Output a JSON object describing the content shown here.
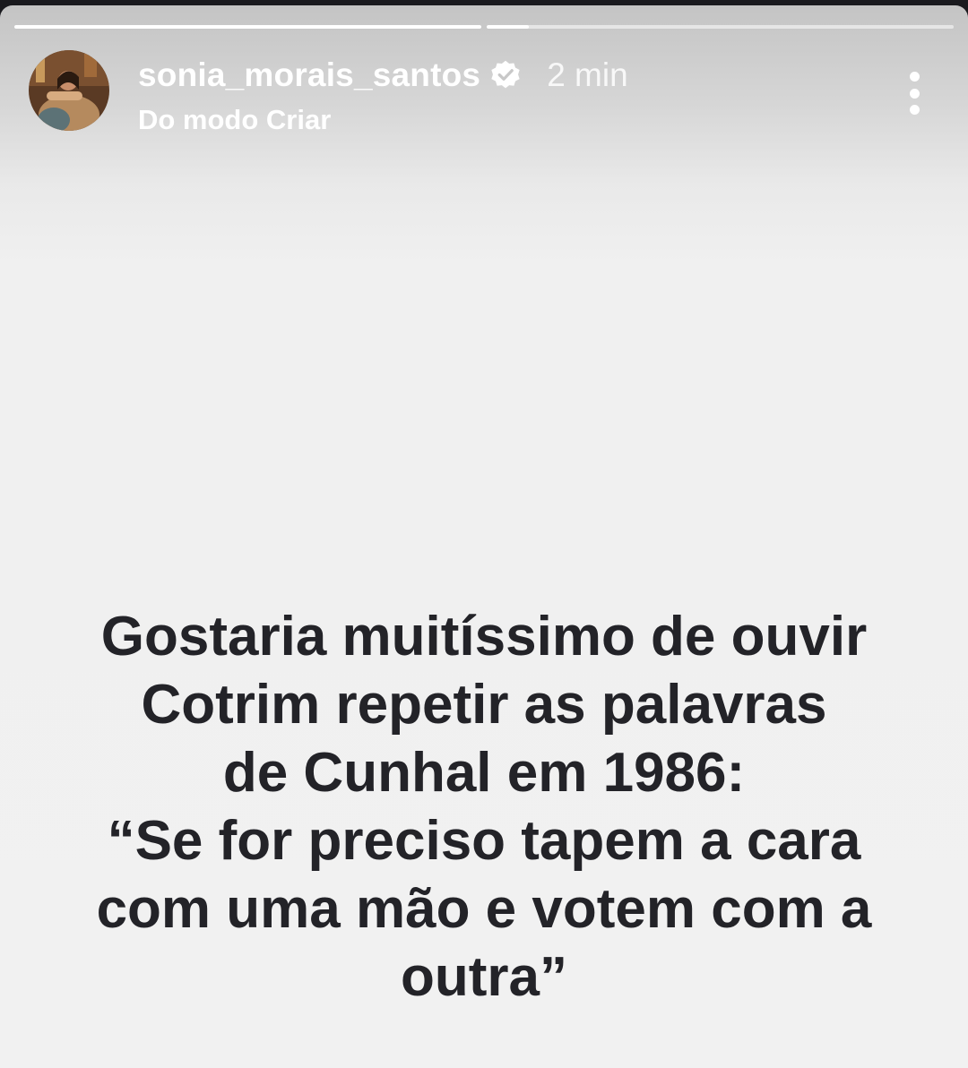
{
  "story": {
    "progress": [
      1.0,
      0.09
    ],
    "username": "sonia_morais_santos",
    "verified_icon": "verified-badge-icon",
    "time": "2 min",
    "subtitle": "Do modo Criar",
    "more_icon": "more-options-icon",
    "message_lines": [
      "Gostaria muitíssimo de ouvir",
      "Cotrim repetir as palavras",
      "de Cunhal em 1986:",
      "“Se for preciso tapem a cara",
      "com uma mão e votem com a",
      "outra”"
    ]
  },
  "colors": {
    "text": "#232328",
    "overlay_text": "#ffffff",
    "background": "#f1f1f1"
  }
}
